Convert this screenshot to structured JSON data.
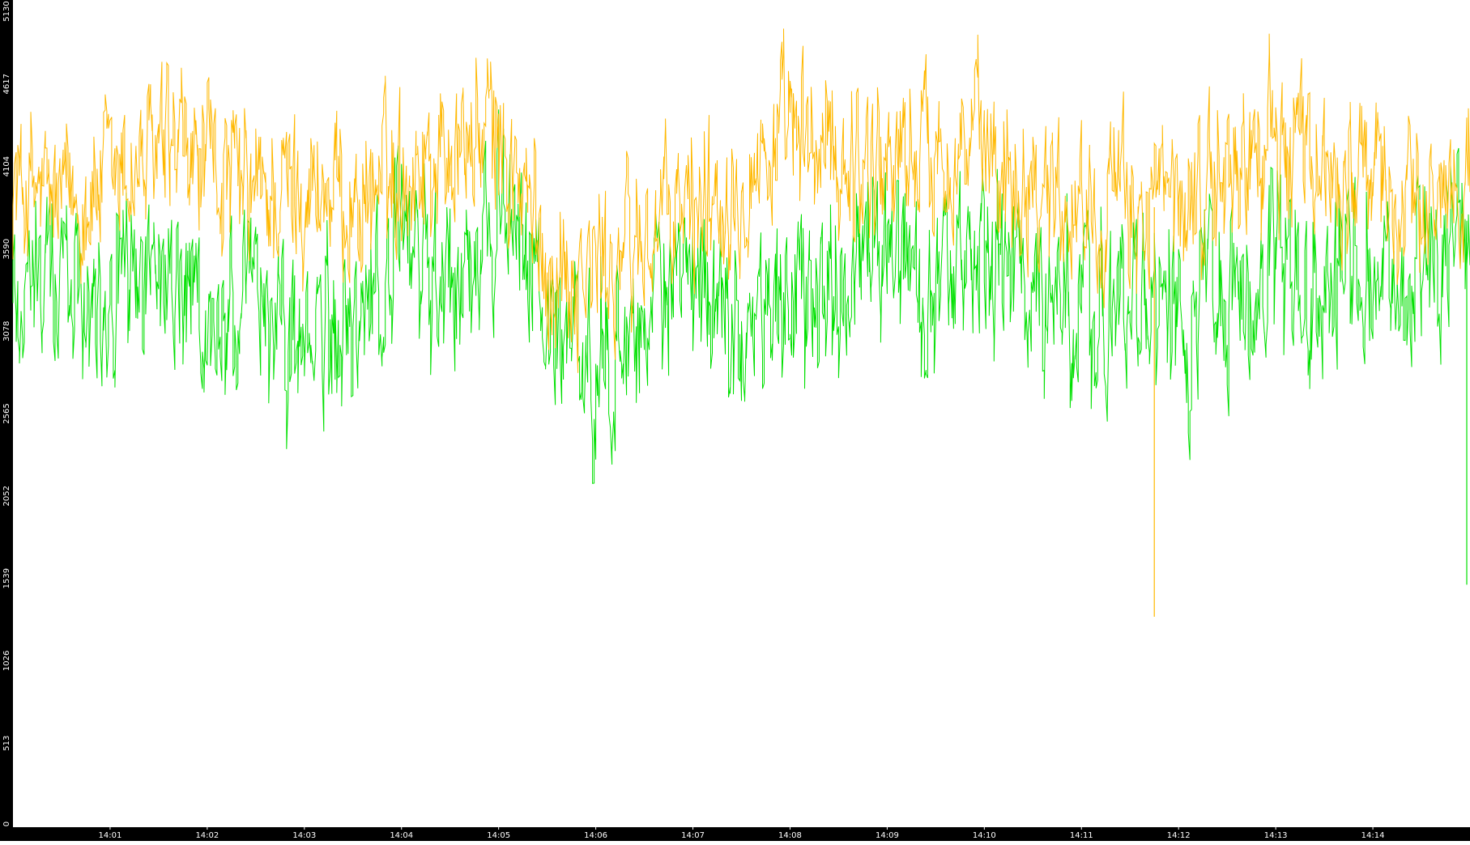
{
  "chart_data": {
    "type": "line",
    "title": "",
    "xlabel": "",
    "ylabel": "",
    "ylim": [
      0,
      5130
    ],
    "xlim": [
      "14:00:00",
      "14:15:00"
    ],
    "grid": false,
    "legend": "none",
    "y_ticks": [
      "0",
      "513",
      "1026",
      "1539",
      "2052",
      "2565",
      "3078",
      "3590",
      "4104",
      "4617",
      "5130"
    ],
    "x_ticks": [
      "14:01",
      "14:02",
      "14:03",
      "14:04",
      "14:05",
      "14:06",
      "14:07",
      "14:08",
      "14:09",
      "14:10",
      "14:11",
      "14:12",
      "14:13",
      "14:14"
    ],
    "x_tick_values": [
      "14:01:00",
      "14:02:00",
      "14:03:00",
      "14:04:00",
      "14:05:00",
      "14:06:00",
      "14:07:00",
      "14:08:00",
      "14:09:00",
      "14:10:00",
      "14:11:00",
      "14:12:00",
      "14:13:00",
      "14:14:00"
    ],
    "colors": {
      "background": "#ffffff",
      "axis_band": "#000000",
      "tick_text": "#ffffff",
      "series_green": "#00e000",
      "series_orange": "#ffb800"
    },
    "series": [
      {
        "color": "#ffb800",
        "x": [
          "14:00:00",
          "14:00:30",
          "14:01:00",
          "14:01:30",
          "14:02:00",
          "14:02:30",
          "14:03:00",
          "14:03:30",
          "14:04:00",
          "14:04:30",
          "14:05:00",
          "14:05:30",
          "14:06:00",
          "14:06:30",
          "14:07:00",
          "14:07:30",
          "14:08:00",
          "14:08:30",
          "14:09:00",
          "14:09:30",
          "14:10:00",
          "14:10:30",
          "14:11:00",
          "14:11:30",
          "14:12:00",
          "14:12:30",
          "14:13:00",
          "14:13:30",
          "14:14:00",
          "14:14:30",
          "14:15:00"
        ],
        "values": [
          4000,
          3850,
          4000,
          4150,
          4100,
          3900,
          4000,
          3850,
          4100,
          4200,
          4300,
          3500,
          3450,
          3650,
          3850,
          4100,
          4250,
          4150,
          4150,
          4250,
          4200,
          4050,
          3900,
          3850,
          3850,
          4050,
          4250,
          4100,
          4050,
          3750,
          4200
        ]
      },
      {
        "color": "#00e000",
        "x": [
          "14:00:00",
          "14:00:30",
          "14:01:00",
          "14:01:30",
          "14:02:00",
          "14:02:30",
          "14:03:00",
          "14:03:30",
          "14:04:00",
          "14:04:30",
          "14:05:00",
          "14:05:30",
          "14:06:00",
          "14:06:30",
          "14:07:00",
          "14:07:30",
          "14:08:00",
          "14:08:30",
          "14:09:00",
          "14:09:30",
          "14:10:00",
          "14:10:30",
          "14:11:00",
          "14:11:30",
          "14:12:00",
          "14:12:30",
          "14:13:00",
          "14:13:30",
          "14:14:00",
          "14:14:30",
          "14:15:00"
        ],
        "values": [
          3300,
          3450,
          3300,
          3450,
          3050,
          3250,
          3000,
          3050,
          3550,
          3300,
          3900,
          3150,
          2900,
          3150,
          3300,
          3200,
          3250,
          3400,
          3550,
          3350,
          3500,
          3400,
          3100,
          3250,
          3050,
          3250,
          3550,
          3400,
          3450,
          3350,
          3650
        ]
      }
    ],
    "annotations": [
      {
        "color": "#ffb800",
        "x": "14:11:45",
        "y": 1300
      },
      {
        "color": "#00e000",
        "x": "14:14:58",
        "y": 1500
      }
    ]
  }
}
